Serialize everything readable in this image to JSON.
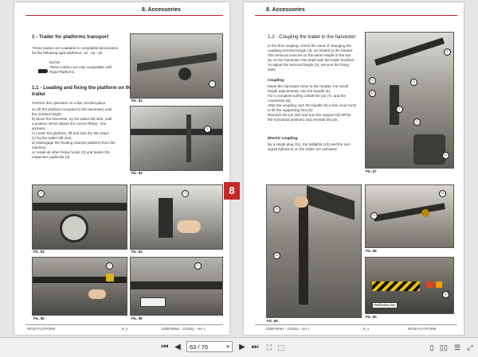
{
  "left_page": {
    "section_header": "8. Accessories",
    "title_trailer": "1 - Trailer for platforms transport",
    "intro_text": "These trailers are available in compatible dimensions\nfor the following rigid platforms: 16 - 18 - 20",
    "note_label": "NOTE:",
    "note_text": "These trailers are only compatible with\nRigid Platforms.",
    "subtitle_loading": "1.1 - Loading and fixing the platform on the\ntrailer",
    "steps_intro": "Perform this operation on a flat, leveled place.",
    "steps": "a)   Lift the platform (coupled to the harvester) until\n      the needed height.\nb)   Move the harvester, by the trailer left side, until\n      a position which allows the correct fitting - see\n      pictures;\nc)   Lower the platform, lift and lock the two stays\n      (1) by the trailer left side;\nd)   Disengage the feeding channel platform from the\n      machine;\ne)   Install all other fixing hooks (2) and fasten the\n      respective padlocks (3).",
    "captions": [
      "Pic. 81",
      "Pic. 82",
      "Pic. 83",
      "Pic. 84",
      "Pic. 85",
      "Pic. 86"
    ],
    "tab_label": "8",
    "footer_left": "RIGID PLATFORM",
    "footer_page": "8_3",
    "footer_code": "628870EM1 - 12/2011 - Ver 1"
  },
  "right_page": {
    "section_header": "8. Accessories",
    "title_coupling": "1.2 - Coupling the trailer in the harvester",
    "coupling_text": "In the first coupling, check the need of changing the\ncoupling terminal height (4), as related to the header.\nThe terminal must be on the same height of the bar\n(5) on the harvester rear shaft with the trailer levelled.\nTo adjust the terminal height (4), remove the fixing\nbolts.",
    "coupling_label": "Coupling:",
    "coupling_steps": "Move the harvester close to the header. For small\nheight adjustments, use the handle (6).\nFor a complete safety, install the pin (7), and the\ncounterpin (8).\nAfter the coupling, turn the handle (6) a few more turns\nto lift the supporting foot (9).\nRemove the pin (10) and turn the support (9) 90º(to\nthe horizontal position) and reinstall the pin.",
    "electric_label": "Electric coupling:",
    "electric_text": "By a single plug (11), the taillights (13) and the turn\nsignal lights(14) on the trailer are activated.",
    "captions": [
      "Pic. 87",
      "Pic. 88",
      "Pic. 89",
      "Pic. 90"
    ],
    "reflective_label": "Reflective bar",
    "tab_label": "8",
    "footer_code": "628870EM1 - 12/2011 - Ver 1",
    "footer_page": "8_4",
    "footer_right": "RIGID PLATFORM"
  },
  "callouts": {
    "pic81": [
      "1"
    ],
    "pic82": [
      "1"
    ],
    "pic83": [
      "3"
    ],
    "pic84": [
      "2"
    ],
    "pic85": [
      "2"
    ],
    "pic86": [
      "1"
    ],
    "pic87": [
      "5",
      "4",
      "6",
      "10",
      "7",
      "9",
      "12"
    ],
    "pic88": [
      "13",
      "4"
    ],
    "pic89": [
      "8",
      "12"
    ],
    "pic90": [
      "14"
    ]
  },
  "toolbar": {
    "page_value": "63 / 70",
    "icons": [
      "first-page-icon",
      "prev-page-icon",
      "next-page-icon",
      "last-page-icon",
      "fit-page-icon",
      "fit-width-icon",
      "single-page-icon",
      "double-page-icon",
      "scroll-view-icon",
      "fullscreen-icon"
    ]
  },
  "colors": {
    "accent_red": "#c62828",
    "page_bg": "#ffffff",
    "viewer_bg": "#e6e6e6"
  }
}
